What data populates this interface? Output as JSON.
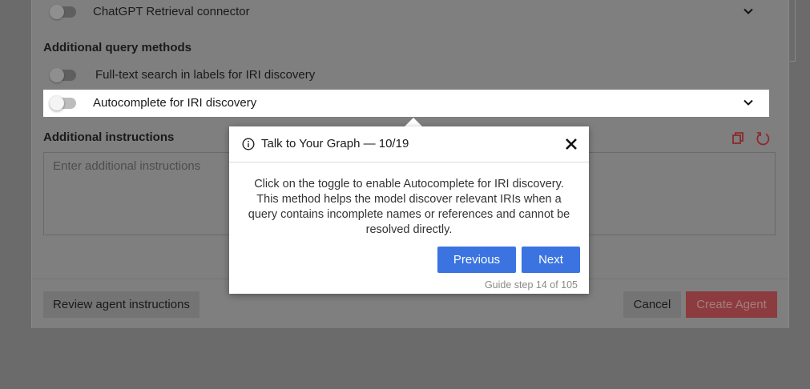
{
  "form": {
    "rows": [
      {
        "label": "ChatGPT Retrieval connector",
        "enabled": false,
        "expandable": true
      },
      {
        "label": "Full-text search in labels for IRI discovery",
        "enabled": false,
        "expandable": false
      },
      {
        "label": "Autocomplete for IRI discovery",
        "enabled": false,
        "expandable": true
      }
    ],
    "additional_query_methods_title": "Additional query methods",
    "additional_instructions_title": "Additional instructions",
    "instructions_placeholder": "Enter additional instructions"
  },
  "footer": {
    "review_label": "Review agent instructions",
    "cancel_label": "Cancel",
    "create_label": "Create Agent"
  },
  "guide": {
    "title": "Talk to Your Graph — 10/19",
    "body": "Click on the toggle to enable Autocomplete for IRI discovery. This method helps the model discover relevant IRIs when a query contains incomplete names or references and cannot be resolved directly.",
    "previous_label": "Previous",
    "next_label": "Next",
    "step_text": "Guide step 14 of 105"
  },
  "colors": {
    "primary_blue": "#3b74e0",
    "create_red": "#8c3c3e",
    "overlay": "#6b6b6b"
  },
  "icons": [
    "chevron-down-icon",
    "copy-icon",
    "reset-icon",
    "info-icon",
    "close-icon"
  ]
}
